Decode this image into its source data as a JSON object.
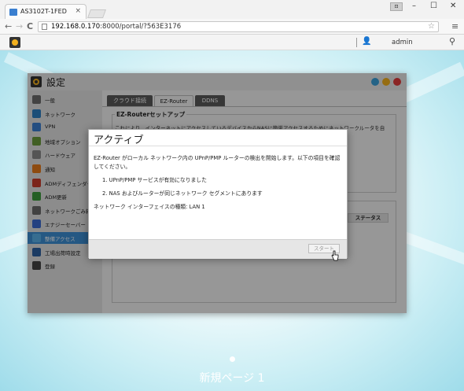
{
  "browser": {
    "tab_title": "AS3102T-1FED",
    "tab_close": "×",
    "profile_btn": "⊡",
    "minimize": "–",
    "maximize": "☐",
    "close": "✕",
    "back": "←",
    "forward": "→",
    "reload": "C",
    "url_host": "192.168.0.170",
    "url_rest": ":8000/portal/?563E3176",
    "star": "☆",
    "menu": "≡"
  },
  "adm_bar": {
    "user_icon": "👤",
    "admin_label": "admin",
    "search_icon": "⚲"
  },
  "settings_window": {
    "title": "設定",
    "sidebar": [
      {
        "label": "一般",
        "color": "#6b6b6b"
      },
      {
        "label": "ネットワーク",
        "color": "#2d7fc2"
      },
      {
        "label": "VPN",
        "color": "#3a7fd0"
      },
      {
        "label": "地域オプション",
        "color": "#6a9a3a"
      },
      {
        "label": "ハードウェア",
        "color": "#8a8a8a"
      },
      {
        "label": "通知",
        "color": "#e67a1a"
      },
      {
        "label": "ADMディフェンダー",
        "color": "#c83a2a"
      },
      {
        "label": "ADM更新",
        "color": "#3a9a3a"
      },
      {
        "label": "ネットワークごみ箱",
        "color": "#6a6a6a"
      },
      {
        "label": "エナジーセーバー",
        "color": "#3a6ad0"
      },
      {
        "label": "整備アクセス",
        "color": "#5ab0e8"
      },
      {
        "label": "工場出荷時設定",
        "color": "#2d5fa0"
      },
      {
        "label": "登録",
        "color": "#444444"
      }
    ],
    "active_index": 10,
    "tabs": [
      "クラウド接続",
      "EZ-Router",
      "DDNS"
    ],
    "selected_tab": 1,
    "section_title": "EZ-Routerセットアップ",
    "section_desc": "これにより、インターネットにアクセスしているデバイスからNASに簡単アクセスするためにネットワークルータを自",
    "column_header": "ステータス"
  },
  "dialog": {
    "title": "アクティブ",
    "line1": "EZ-Router がローカル ネットワーク内の UPnP/PMP ルーターの検出を開始します。以下の項目を確認",
    "line2": "してください。",
    "item1": "1. UPnP/PMP サービスが有効になりました",
    "item2": "2. NAS およびルーターが同じネットワーク セグメントにあります",
    "interface": "ネットワーク インターフェイスの種類: LAN 1",
    "start_button": "スタート"
  },
  "desktop": {
    "page_label": "新規ページ 1"
  },
  "colors": {
    "help": "#3aa0d8",
    "minimize": "#f2b01e",
    "close": "#e03a3a",
    "sidebar_active": "#3d8fd4"
  }
}
